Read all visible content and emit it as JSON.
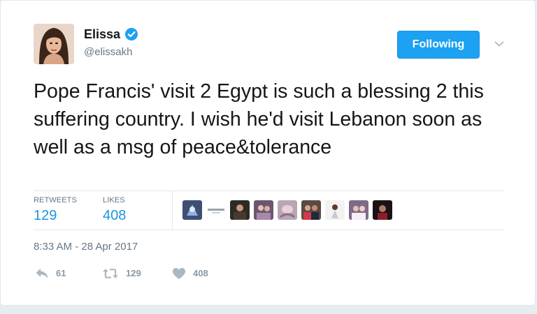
{
  "author": {
    "display_name": "Elissa",
    "screen_name": "@elissakh",
    "verified_icon": "verified-badge-icon",
    "avatar_icon": "profile-avatar"
  },
  "follow_button": {
    "label": "Following"
  },
  "caret_icon": "chevron-down-icon",
  "tweet": {
    "text": "Pope Francis' visit 2 Egypt is such a blessing 2 this suffering country. I wish he'd visit Lebanon soon as well as a msg of peace&tolerance"
  },
  "stats": {
    "retweets_label": "RETWEETS",
    "retweets_value": "129",
    "likes_label": "LIKES",
    "likes_value": "408"
  },
  "timestamp": "8:33 AM - 28 Apr 2017",
  "actions": {
    "reply_count": "61",
    "retweet_count": "129",
    "like_count": "408"
  },
  "colors": {
    "accent": "#1da1f2",
    "link": "#1b95e0",
    "text": "#14171a",
    "secondary": "#657786",
    "action_gray": "#8899a6",
    "border": "#e1e8ed"
  }
}
